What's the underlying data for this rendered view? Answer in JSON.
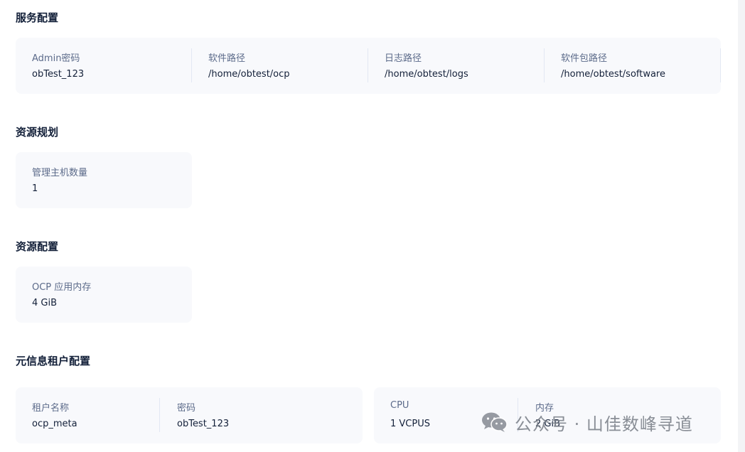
{
  "service_config": {
    "title": "服务配置",
    "fields": [
      {
        "label": "Admin密码",
        "value": "obTest_123"
      },
      {
        "label": "软件路径",
        "value": "/home/obtest/ocp"
      },
      {
        "label": "日志路径",
        "value": "/home/obtest/logs"
      },
      {
        "label": "软件包路径",
        "value": "/home/obtest/software"
      }
    ]
  },
  "resource_plan": {
    "title": "资源规划",
    "fields": [
      {
        "label": "管理主机数量",
        "value": "1"
      }
    ]
  },
  "resource_config": {
    "title": "资源配置",
    "fields": [
      {
        "label": "OCP 应用内存",
        "value": "4 GiB"
      }
    ]
  },
  "meta_tenant_config": {
    "title": "元信息租户配置",
    "left_fields": [
      {
        "label": "租户名称",
        "value": "ocp_meta"
      },
      {
        "label": "密码",
        "value": "obTest_123"
      }
    ],
    "right_fields": [
      {
        "label": "CPU",
        "value": "1 VCPUS"
      },
      {
        "label": "内存",
        "value": "2 GiB"
      }
    ]
  },
  "watermark": {
    "icon": "wechat-icon",
    "text": "公众号 · 山佳数峰寻道"
  }
}
